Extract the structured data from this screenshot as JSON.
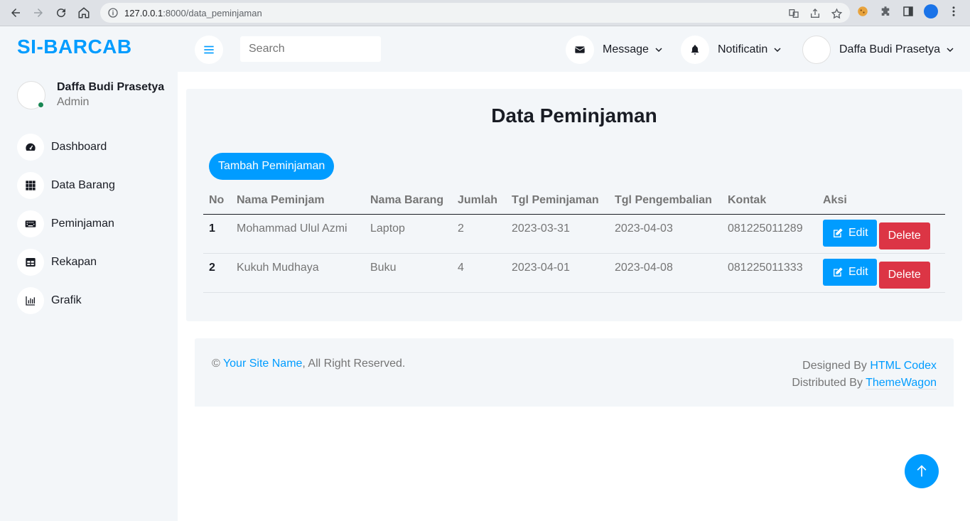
{
  "browser": {
    "url_host": "127.0.0.1",
    "url_path": ":8000/data_peminjaman"
  },
  "sidebar": {
    "brand": "SI-BARCAB",
    "user_name": "Daffa Budi Prasetya",
    "user_role": "Admin",
    "items": [
      {
        "label": "Dashboard",
        "icon": "tachometer-icon"
      },
      {
        "label": "Data Barang",
        "icon": "grid-icon"
      },
      {
        "label": "Peminjaman",
        "icon": "keyboard-icon"
      },
      {
        "label": "Rekapan",
        "icon": "table-icon"
      },
      {
        "label": "Grafik",
        "icon": "chart-bar-icon"
      }
    ]
  },
  "topnav": {
    "search_placeholder": "Search",
    "message_label": "Message",
    "notification_label": "Notificatin",
    "profile_name": "Daffa Budi Prasetya"
  },
  "main": {
    "title": "Data Peminjaman",
    "add_button": "Tambah Peminjaman",
    "columns": [
      "No",
      "Nama Peminjam",
      "Nama Barang",
      "Jumlah",
      "Tgl Peminjaman",
      "Tgl Pengembalian",
      "Kontak",
      "Aksi"
    ],
    "rows": [
      {
        "no": "1",
        "nama": "Mohammad Ulul Azmi",
        "barang": "Laptop",
        "jumlah": "2",
        "tgl_pinjam": "2023-03-31",
        "tgl_kembali": "2023-04-03",
        "kontak": "081225011289"
      },
      {
        "no": "2",
        "nama": "Kukuh Mudhaya",
        "barang": "Buku",
        "jumlah": "4",
        "tgl_pinjam": "2023-04-01",
        "tgl_kembali": "2023-04-08",
        "kontak": "081225011333"
      }
    ],
    "edit_label": "Edit",
    "delete_label": "Delete"
  },
  "footer": {
    "copyright_symbol": "©",
    "site_name": "Your Site Name",
    "rights": ", All Right Reserved.",
    "designed_by": "Designed By",
    "designer": "HTML Codex",
    "distributed_by": "Distributed By",
    "distributor": "ThemeWagon"
  },
  "colors": {
    "primary": "#009cff",
    "danger": "#dc3545",
    "panel": "#f3f6f9",
    "dark": "#191c24"
  }
}
